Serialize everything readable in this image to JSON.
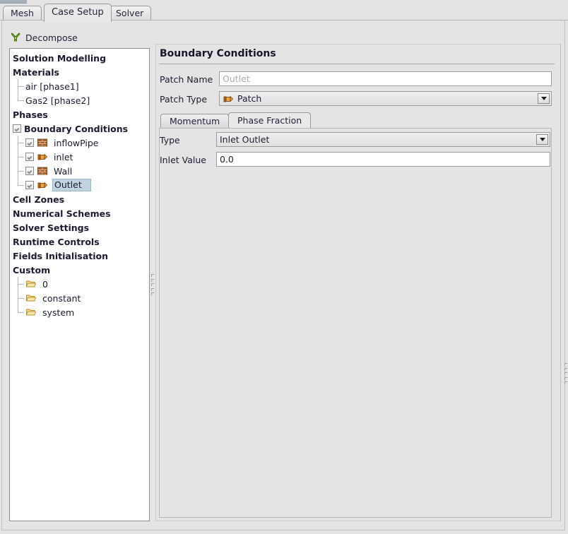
{
  "window": {
    "tabs": [
      {
        "label": "Mesh",
        "selected": false
      },
      {
        "label": "Case Setup",
        "selected": true
      },
      {
        "label": "Solver",
        "selected": false
      }
    ]
  },
  "toolbar": {
    "decompose_label": "Decompose",
    "decompose_icon": "decompose-icon"
  },
  "tree": {
    "items": [
      {
        "label": "Solution Modelling",
        "level": 0,
        "bold": true,
        "icon": null,
        "checkbox": null,
        "selected": false,
        "connector": "none"
      },
      {
        "label": "Materials",
        "level": 0,
        "bold": true,
        "icon": null,
        "checkbox": null,
        "selected": false,
        "connector": "none"
      },
      {
        "label": "air [phase1]",
        "level": 1,
        "bold": false,
        "icon": null,
        "checkbox": null,
        "selected": false,
        "connector": "tee"
      },
      {
        "label": "Gas2 [phase2]",
        "level": 1,
        "bold": false,
        "icon": null,
        "checkbox": null,
        "selected": false,
        "connector": "end"
      },
      {
        "label": "Phases",
        "level": 0,
        "bold": true,
        "icon": null,
        "checkbox": null,
        "selected": false,
        "connector": "none"
      },
      {
        "label": "Boundary Conditions",
        "level": 0,
        "bold": true,
        "icon": null,
        "checkbox": true,
        "selected": false,
        "connector": "none"
      },
      {
        "label": "inflowPipe",
        "level": 1,
        "bold": false,
        "icon": "wall-icon",
        "checkbox": true,
        "selected": false,
        "connector": "tee"
      },
      {
        "label": "inlet",
        "level": 1,
        "bold": false,
        "icon": "patch-icon",
        "checkbox": true,
        "selected": false,
        "connector": "tee"
      },
      {
        "label": "Wall",
        "level": 1,
        "bold": false,
        "icon": "wall-icon",
        "checkbox": true,
        "selected": false,
        "connector": "tee"
      },
      {
        "label": "Outlet",
        "level": 1,
        "bold": false,
        "icon": "patch-icon",
        "checkbox": true,
        "selected": true,
        "connector": "end"
      },
      {
        "label": "Cell Zones",
        "level": 0,
        "bold": true,
        "icon": null,
        "checkbox": null,
        "selected": false,
        "connector": "none"
      },
      {
        "label": "Numerical Schemes",
        "level": 0,
        "bold": true,
        "icon": null,
        "checkbox": null,
        "selected": false,
        "connector": "none"
      },
      {
        "label": "Solver Settings",
        "level": 0,
        "bold": true,
        "icon": null,
        "checkbox": null,
        "selected": false,
        "connector": "none"
      },
      {
        "label": "Runtime Controls",
        "level": 0,
        "bold": true,
        "icon": null,
        "checkbox": null,
        "selected": false,
        "connector": "none"
      },
      {
        "label": "Fields Initialisation",
        "level": 0,
        "bold": true,
        "icon": null,
        "checkbox": null,
        "selected": false,
        "connector": "none"
      },
      {
        "label": "Custom",
        "level": 0,
        "bold": true,
        "icon": null,
        "checkbox": null,
        "selected": false,
        "connector": "none"
      },
      {
        "label": "0",
        "level": 1,
        "bold": false,
        "icon": "folder-icon",
        "checkbox": null,
        "selected": false,
        "connector": "tee"
      },
      {
        "label": "constant",
        "level": 1,
        "bold": false,
        "icon": "folder-icon",
        "checkbox": null,
        "selected": false,
        "connector": "tee"
      },
      {
        "label": "system",
        "level": 1,
        "bold": false,
        "icon": "folder-icon",
        "checkbox": null,
        "selected": false,
        "connector": "end"
      }
    ]
  },
  "panel": {
    "title": "Boundary Conditions",
    "patch_name": {
      "label": "Patch Name",
      "value": "Outlet",
      "disabled": true
    },
    "patch_type": {
      "label": "Patch Type",
      "value": "Patch",
      "icon": "patch-icon"
    },
    "inner_tabs": [
      {
        "label": "Momentum",
        "selected": false
      },
      {
        "label": "Phase Fraction",
        "selected": true
      }
    ],
    "type_field": {
      "label": "Type",
      "value": "Inlet Outlet"
    },
    "inlet_value_field": {
      "label": "Inlet Value",
      "value": "0.0"
    }
  },
  "colors": {
    "window_bg": "#e4e4e4",
    "panel_bg": "#e4e4e4",
    "tree_bg": "#ffffff",
    "selection": "#bfd3e0",
    "accent_green": "#7ab51d",
    "patch_orange": "#e8962f",
    "wall_brown": "#a0522d",
    "folder_yellow": "#f2c14e"
  }
}
